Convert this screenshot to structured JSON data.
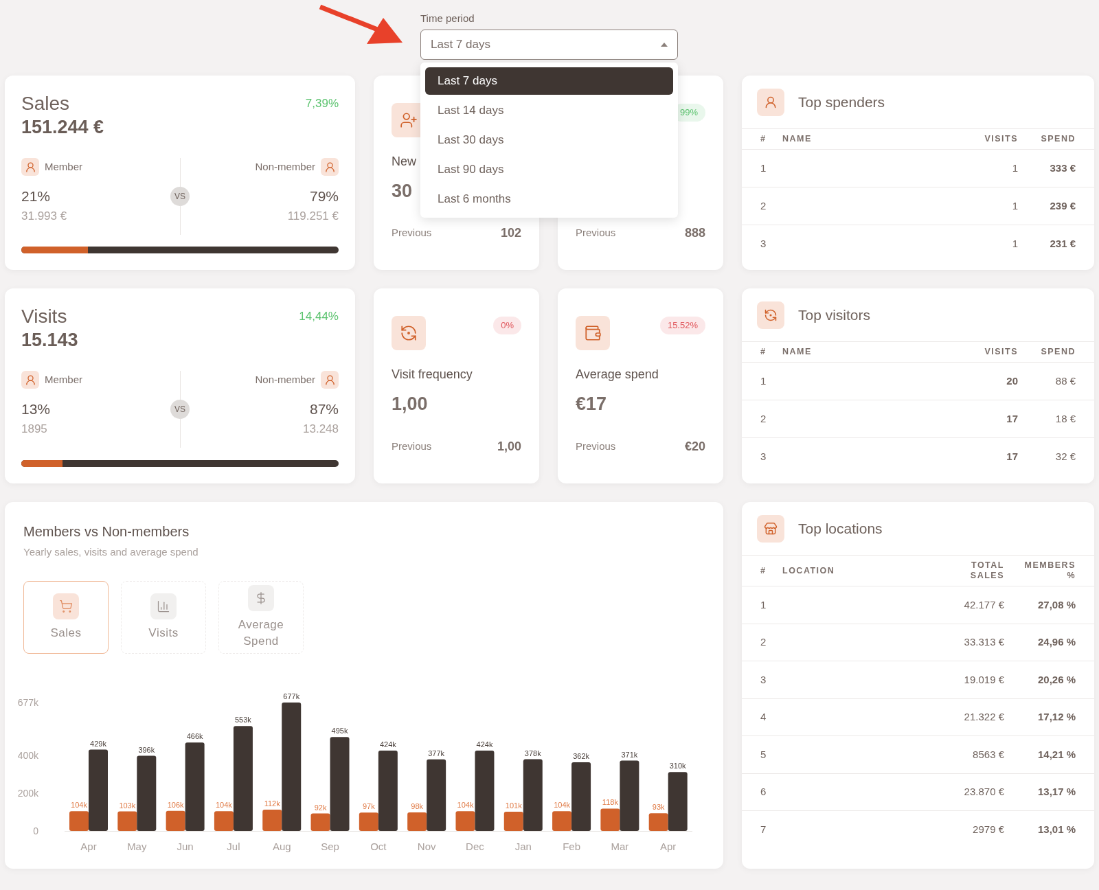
{
  "time_period": {
    "label": "Time period",
    "value": "Last 7 days",
    "expanded": true,
    "options": [
      {
        "label": "Last 7 days",
        "selected": true
      },
      {
        "label": "Last 14 days",
        "selected": false
      },
      {
        "label": "Last 30 days",
        "selected": false
      },
      {
        "label": "Last 90 days",
        "selected": false
      },
      {
        "label": "Last 6 months",
        "selected": false
      }
    ]
  },
  "rows": [
    {
      "summary": {
        "title": "Sales",
        "value": "151.244 €",
        "change": "7,39%",
        "member": {
          "label": "Member",
          "share": "21%",
          "amount": "31.993 €"
        },
        "vs": "VS",
        "non_member": {
          "label": "Non-member",
          "share": "79%",
          "amount": "119.251 €"
        },
        "level": 0.21
      },
      "metrics": [
        {
          "kind": "new_members",
          "title": "New",
          "value": "30",
          "previous_label": "Previous",
          "previous": "102"
        },
        {
          "kind": "covered",
          "badge": "99%",
          "color": "#5cc36f",
          "previous_label": "Previous",
          "previous": "888"
        }
      ],
      "table": {
        "title": "Top spenders",
        "columns": [
          "#",
          "NAME",
          "VISITS",
          "SPEND"
        ],
        "rows": [
          {
            "rank": "1",
            "visits": "1",
            "spend": "333 €"
          },
          {
            "rank": "2",
            "visits": "1",
            "spend": "239 €"
          },
          {
            "rank": "3",
            "visits": "1",
            "spend": "231 €"
          }
        ]
      }
    },
    {
      "summary": {
        "title": "Visits",
        "value": "15.143",
        "change": "14,44%",
        "member": {
          "label": "Member",
          "share": "13%",
          "amount": "1895"
        },
        "vs": "VS",
        "non_member": {
          "label": "Non-member",
          "share": "87%",
          "amount": "13.248"
        },
        "level": 0.13
      },
      "metrics": [
        {
          "kind": "visit_frequency",
          "badge": "0%",
          "color": "#e0565b",
          "title": "Visit frequency",
          "value": "1,00",
          "previous_label": "Previous",
          "previous": "1,00"
        },
        {
          "kind": "average_spend",
          "badge": "15.52%",
          "color": "#e0565b",
          "title": "Average spend",
          "value": "€17",
          "previous_label": "Previous",
          "previous": "€20"
        }
      ],
      "table": {
        "title": "Top visitors",
        "columns": [
          "#",
          "NAME",
          "VISITS",
          "SPEND"
        ],
        "rows": [
          {
            "rank": "1",
            "visits": "20",
            "spend": "88 €"
          },
          {
            "rank": "2",
            "visits": "17",
            "spend": "18 €"
          },
          {
            "rank": "3",
            "visits": "17",
            "spend": "32 €"
          }
        ]
      }
    }
  ],
  "members_chart": {
    "title": "Members vs Non-members",
    "subtitle": "Yearly sales, visits and average spend",
    "tabs": [
      {
        "label": "Sales",
        "kind": "sales",
        "selected": true
      },
      {
        "label": "Visits",
        "kind": "visits",
        "selected": false
      },
      {
        "label": "Average Spend",
        "kind": "spend",
        "selected": false
      }
    ],
    "chart_data": {
      "type": "bar",
      "categories": [
        "Apr",
        "May",
        "Jun",
        "Jul",
        "Aug",
        "Sep",
        "Oct",
        "Nov",
        "Dec",
        "Jan",
        "Feb",
        "Mar",
        "Apr"
      ],
      "series": [
        {
          "color": "#d0612a",
          "values": [
            104,
            103,
            106,
            104,
            112,
            92,
            97,
            98,
            104,
            101,
            104,
            118,
            93
          ],
          "value_labels": [
            "104k",
            "103k",
            "106k",
            "104k",
            "112k",
            "92k",
            "97k",
            "98k",
            "104k",
            "101k",
            "104k",
            "118k",
            "93k"
          ]
        },
        {
          "color": "#3f3632",
          "values": [
            429,
            396,
            466,
            553,
            677,
            495,
            424,
            377,
            424,
            378,
            362,
            371,
            310
          ],
          "value_labels": [
            "429k",
            "396k",
            "466k",
            "553k",
            "677k",
            "495k",
            "424k",
            "377k",
            "424k",
            "378k",
            "362k",
            "371k",
            "310k"
          ]
        }
      ],
      "ylim": [
        0,
        677
      ],
      "yticks": [
        {
          "value": 0,
          "label": "0"
        },
        {
          "value": 200,
          "label": "200k"
        },
        {
          "value": 400,
          "label": "400k"
        },
        {
          "value": 677,
          "label": "677k"
        }
      ],
      "data_labels": true
    }
  },
  "top_locations": {
    "title": "Top locations",
    "columns": [
      "#",
      "LOCATION",
      "TOTAL SALES",
      "MEMBERS %"
    ],
    "rows": [
      {
        "rank": "1",
        "total_sales": "42.177 €",
        "members": "27,08 %"
      },
      {
        "rank": "2",
        "total_sales": "33.313 €",
        "members": "24,96 %"
      },
      {
        "rank": "3",
        "total_sales": "19.019 €",
        "members": "20,26 %"
      },
      {
        "rank": "4",
        "total_sales": "21.322 €",
        "members": "17,12 %"
      },
      {
        "rank": "5",
        "total_sales": "8563 €",
        "members": "14,21 %"
      },
      {
        "rank": "6",
        "total_sales": "23.870 €",
        "members": "13,17 %"
      },
      {
        "rank": "7",
        "total_sales": "2979 €",
        "members": "13,01 %"
      }
    ]
  }
}
